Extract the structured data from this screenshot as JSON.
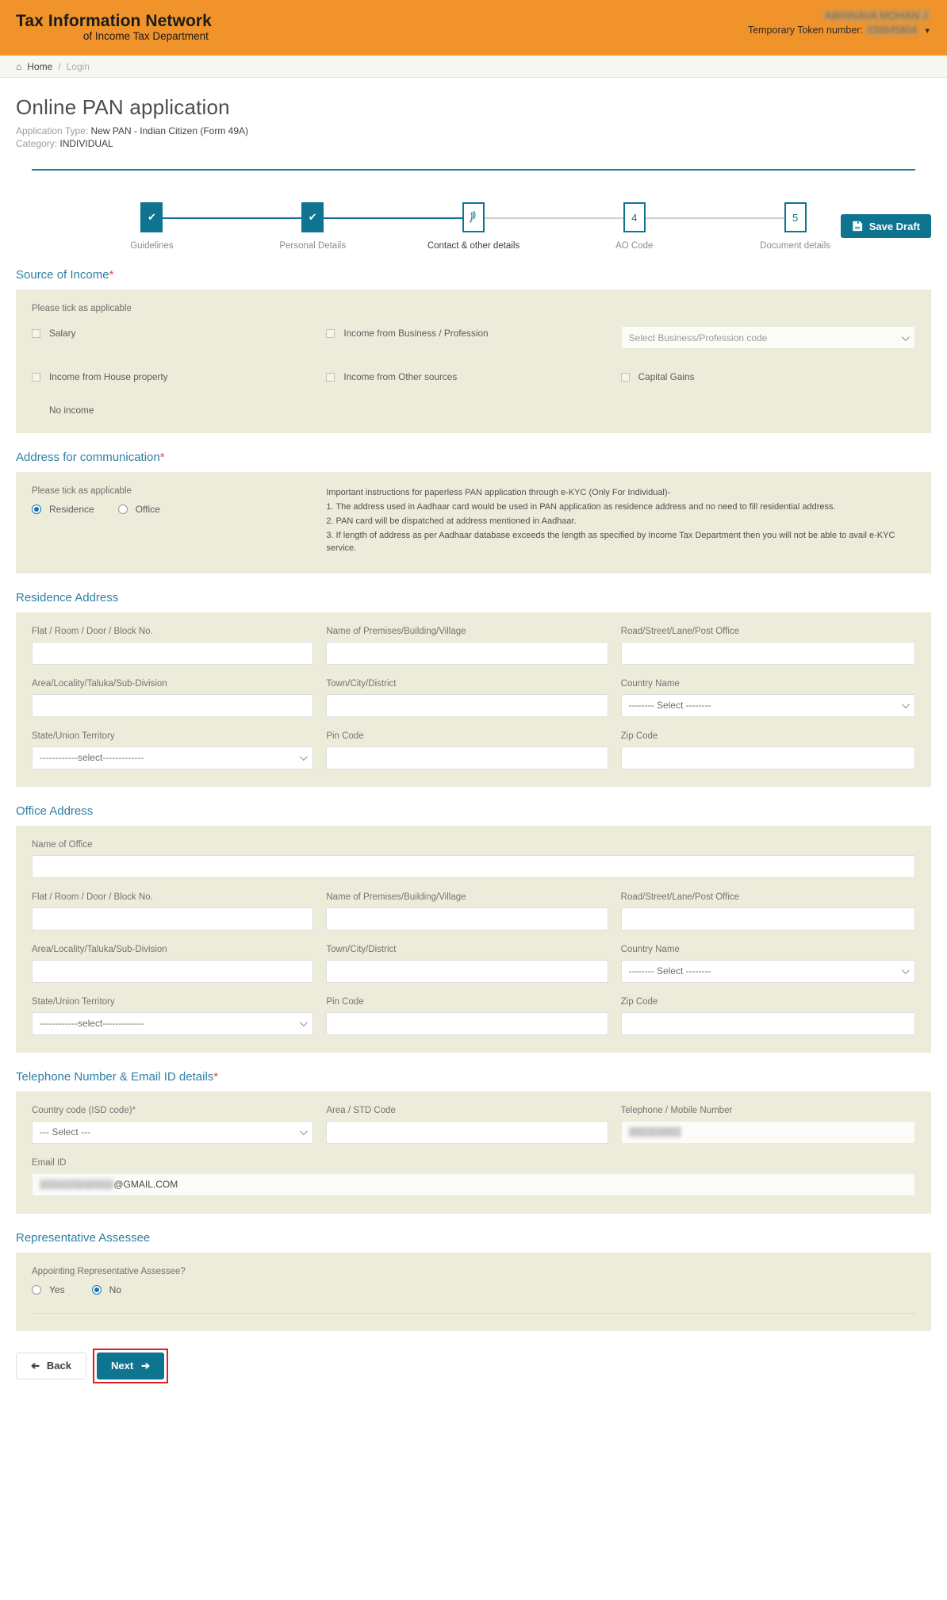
{
  "header": {
    "brand_line1": "Tax Information Network",
    "brand_line2": "of Income Tax Department",
    "user_name": "ABHINAVA MOHAN J",
    "token_label": "Temporary Token number:",
    "token_value": "039945804",
    "caret_icon": "chevron-down-icon"
  },
  "breadcrumb": {
    "home_icon": "home-icon",
    "home": "Home",
    "separator": "/",
    "current": "Login"
  },
  "page": {
    "title": "Online PAN application",
    "application_type_label": "Application Type:",
    "application_type_value": "New PAN - Indian Citizen (Form 49A)",
    "category_label": "Category:",
    "category_value": "INDIVIDUAL",
    "save_draft_label": "Save Draft",
    "save_draft_icon": "floppy-disk-icon"
  },
  "stepper": {
    "steps": [
      {
        "label": "Guidelines",
        "marker": "✔",
        "state": "done"
      },
      {
        "label": "Personal Details",
        "marker": "✔",
        "state": "done"
      },
      {
        "label": "Contact & other details",
        "marker": "pen-icon",
        "state": "active"
      },
      {
        "label": "AO Code",
        "marker": "4",
        "state": "idle"
      },
      {
        "label": "Document details",
        "marker": "5",
        "state": "idle"
      }
    ]
  },
  "source_of_income": {
    "heading": "Source of Income",
    "required_mark": "*",
    "hint": "Please tick as applicable",
    "options": [
      {
        "label": "Salary",
        "checked": false
      },
      {
        "label": "Income from Business / Profession",
        "checked": false
      },
      {
        "label": "Income from House property",
        "checked": false
      },
      {
        "label": "Income from Other sources",
        "checked": false
      },
      {
        "label": "Capital Gains",
        "checked": false
      }
    ],
    "business_code_placeholder": "Select Business/Profession code",
    "no_income_label": "No income"
  },
  "address_communication": {
    "heading": "Address for communication",
    "required_mark": "*",
    "hint": "Please tick as applicable",
    "options": [
      {
        "label": "Residence",
        "selected": true
      },
      {
        "label": "Office",
        "selected": false
      }
    ],
    "instructions_title": "Important instructions for paperless PAN application through e-KYC (Only For Individual)-",
    "instructions": [
      "1. The address used in Aadhaar card would be used in PAN application as residence address and no need to fill residential address.",
      "2. PAN card will be dispatched at address mentioned in Aadhaar.",
      "3. If length of address as per Aadhaar database exceeds the length as specified by Income Tax Department then you will not be able to avail e-KYC service."
    ]
  },
  "residence_address": {
    "heading": "Residence Address",
    "fields": {
      "flat": {
        "label": "Flat / Room / Door / Block No.",
        "value": ""
      },
      "premises": {
        "label": "Name of Premises/Building/Village",
        "value": ""
      },
      "road": {
        "label": "Road/Street/Lane/Post Office",
        "value": ""
      },
      "area": {
        "label": "Area/Locality/Taluka/Sub-Division",
        "value": ""
      },
      "town": {
        "label": "Town/City/District",
        "value": ""
      },
      "country": {
        "label": "Country Name",
        "value": "-------- Select --------"
      },
      "state": {
        "label": "State/Union Territory",
        "value": "------------select-------------"
      },
      "pin": {
        "label": "Pin Code",
        "value": ""
      },
      "zip": {
        "label": "Zip Code",
        "value": ""
      }
    }
  },
  "office_address": {
    "heading": "Office Address",
    "fields": {
      "office_name": {
        "label": "Name of Office",
        "value": ""
      },
      "flat": {
        "label": "Flat / Room / Door / Block No.",
        "value": ""
      },
      "premises": {
        "label": "Name of Premises/Building/Village",
        "value": ""
      },
      "road": {
        "label": "Road/Street/Lane/Post Office",
        "value": ""
      },
      "area": {
        "label": "Area/Locality/Taluka/Sub-Division",
        "value": ""
      },
      "town": {
        "label": "Town/City/District",
        "value": ""
      },
      "country": {
        "label": "Country Name",
        "value": "-------- Select --------"
      },
      "state": {
        "label": "State/Union Territory",
        "value": "------------select-------------"
      },
      "pin": {
        "label": "Pin Code",
        "value": ""
      },
      "zip": {
        "label": "Zip Code",
        "value": ""
      }
    }
  },
  "telephone_email": {
    "heading": "Telephone Number & Email ID details",
    "required_mark": "*",
    "fields": {
      "isd": {
        "label": "Country code (ISD code)",
        "required_mark": "*",
        "value": "--- Select ---"
      },
      "std": {
        "label": "Area / STD Code",
        "value": ""
      },
      "phone": {
        "label": "Telephone / Mobile Number",
        "value": "9962838891"
      },
      "email": {
        "label": "Email ID",
        "value_masked": "vishnucharanmvv",
        "value_visible": "@GMAIL.COM"
      }
    }
  },
  "representative_assessee": {
    "heading": "Representative Assessee",
    "question": "Appointing Representative Assessee?",
    "options": [
      {
        "label": "Yes",
        "selected": false
      },
      {
        "label": "No",
        "selected": true
      }
    ]
  },
  "footer": {
    "back_label": "Back",
    "back_icon": "arrow-left-icon",
    "next_label": "Next",
    "next_icon": "arrow-right-icon"
  },
  "colors": {
    "brand_orange": "#f0932b",
    "teal": "#0e7490",
    "panel": "#edecdb",
    "section_heading": "#2e7fa3",
    "highlight_red": "#e02020"
  }
}
